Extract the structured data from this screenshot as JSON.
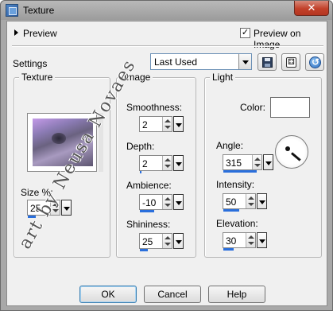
{
  "window": {
    "title": "Texture",
    "close_glyph": "✕"
  },
  "top": {
    "preview_label": "Preview",
    "preview_on_image_label": "Preview on Image",
    "preview_on_image_checked": true,
    "check_glyph": "✓"
  },
  "settings": {
    "label": "Settings",
    "preset_value": "Last Used"
  },
  "texture_group": {
    "title": "Texture",
    "size_label": "Size %:",
    "size_value": "25"
  },
  "image_group": {
    "title": "Image",
    "fields": [
      {
        "label": "Smoothness:",
        "value": "2",
        "level": 0.0
      },
      {
        "label": "Depth:",
        "value": "2",
        "level": 0.05
      },
      {
        "label": "Ambience:",
        "value": "-10",
        "level": 0.45
      },
      {
        "label": "Shininess:",
        "value": "25",
        "level": 0.25
      }
    ]
  },
  "light_group": {
    "title": "Light",
    "color_label": "Color:",
    "color_value": "#ffffff",
    "angle_label": "Angle:",
    "angle_value": "315",
    "angle_level": 0.87,
    "intensity_label": "Intensity:",
    "intensity_value": "50",
    "intensity_level": 0.5,
    "elevation_label": "Elevation:",
    "elevation_value": "30",
    "elevation_level": 0.33
  },
  "buttons": {
    "ok": "OK",
    "cancel": "Cancel",
    "help": "Help"
  },
  "watermark": {
    "text": "art by Neusa Novaes"
  },
  "colors": {
    "window_frame": "#a8a8a8",
    "panel": "#f0f0f0",
    "accent": "#2a6fdc",
    "close": "#c2412a"
  }
}
